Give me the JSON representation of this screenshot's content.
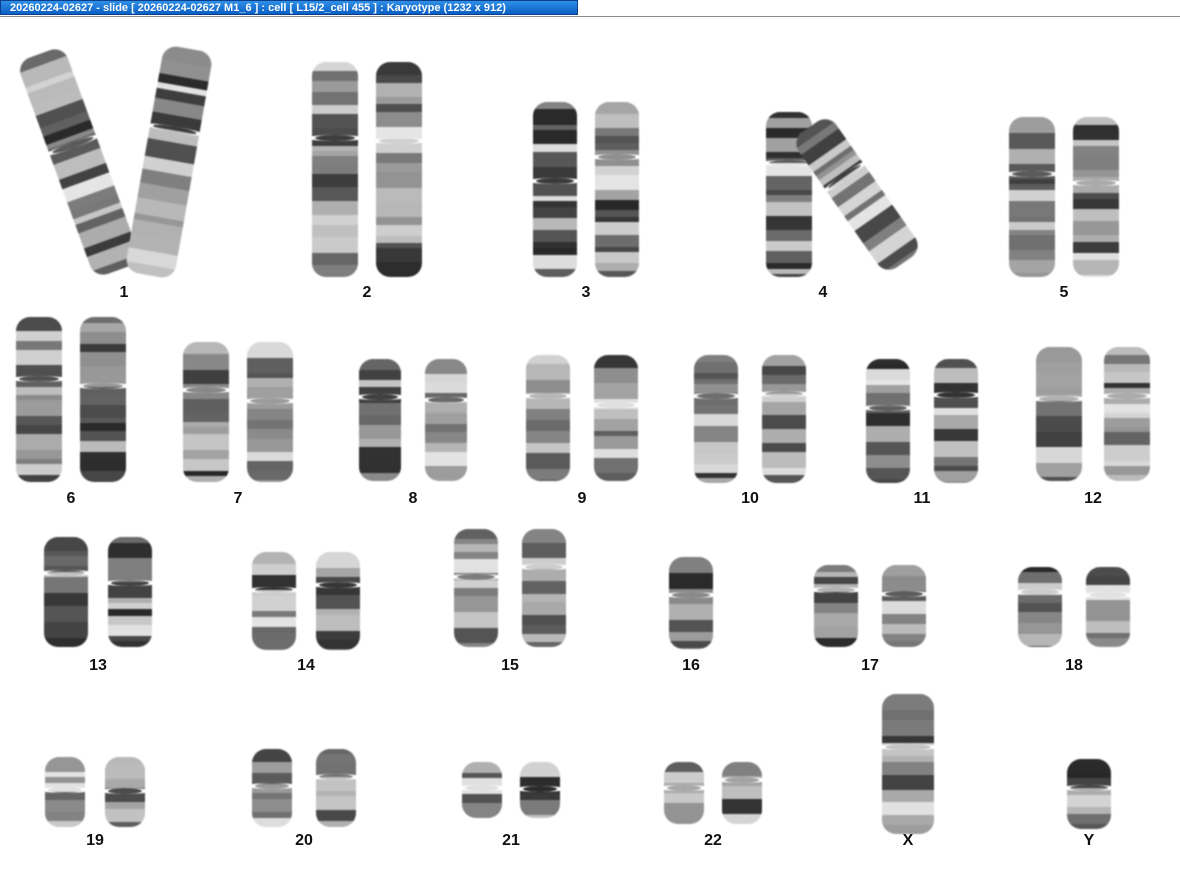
{
  "window": {
    "title": "20260224-02627 - slide [ 20260224-02627 M1_6 ] : cell [ L15/2_cell 455 ] : Karyotype  (1232 x 912)"
  },
  "karyotype": {
    "chromosomes": [
      {
        "label": "1"
      },
      {
        "label": "2"
      },
      {
        "label": "3"
      },
      {
        "label": "4"
      },
      {
        "label": "5"
      },
      {
        "label": "6"
      },
      {
        "label": "7"
      },
      {
        "label": "8"
      },
      {
        "label": "9"
      },
      {
        "label": "10"
      },
      {
        "label": "11"
      },
      {
        "label": "12"
      },
      {
        "label": "13"
      },
      {
        "label": "14"
      },
      {
        "label": "15"
      },
      {
        "label": "16"
      },
      {
        "label": "17"
      },
      {
        "label": "18"
      },
      {
        "label": "19"
      },
      {
        "label": "20"
      },
      {
        "label": "21"
      },
      {
        "label": "22"
      },
      {
        "label": "X"
      },
      {
        "label": "Y"
      }
    ]
  },
  "colors": {
    "titlebar": "#0a5fc4",
    "background": "#ffffff",
    "chromosome_dark": "#2a2a2a",
    "chromosome_light": "#cfcfcf"
  }
}
